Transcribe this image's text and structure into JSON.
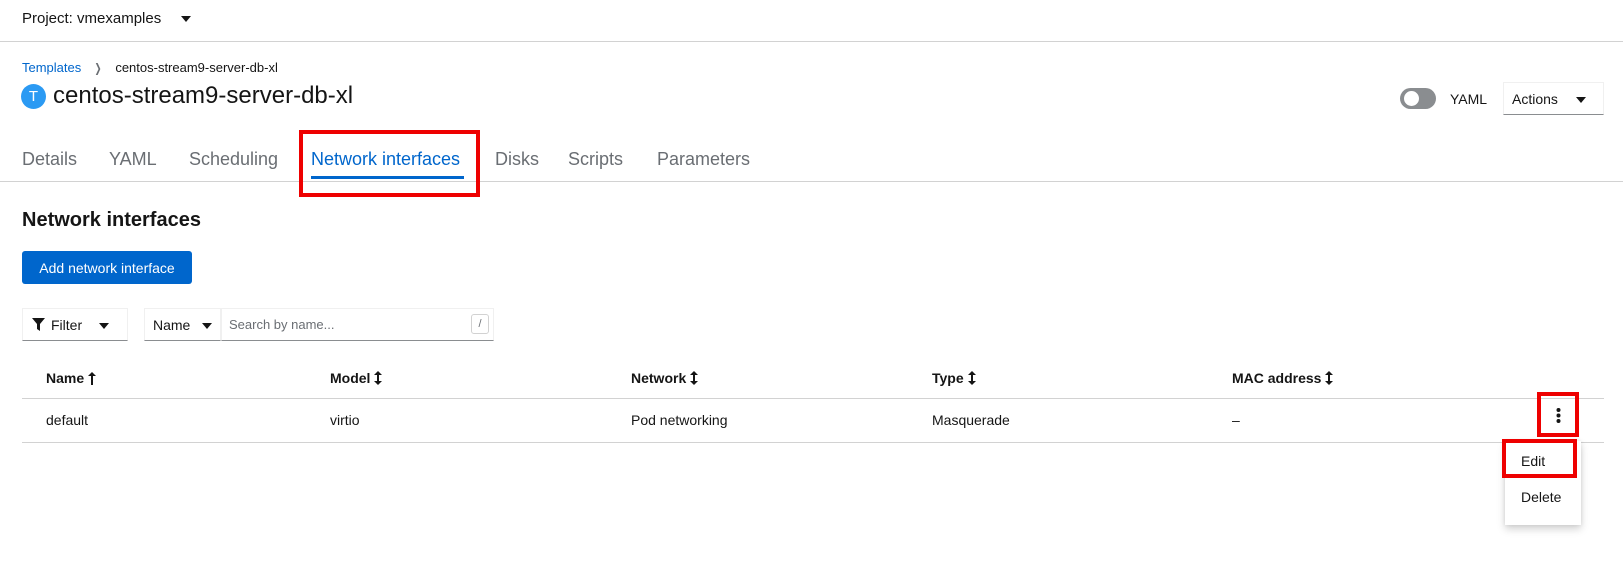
{
  "project": {
    "label": "Project: vmexamples"
  },
  "breadcrumb": {
    "parent": "Templates",
    "current": "centos-stream9-server-db-xl"
  },
  "header": {
    "badge": "T",
    "title": "centos-stream9-server-db-xl",
    "yaml_switch_label": "YAML",
    "actions_label": "Actions"
  },
  "tabs": [
    {
      "label": "Details"
    },
    {
      "label": "YAML"
    },
    {
      "label": "Scheduling"
    },
    {
      "label": "Network interfaces",
      "active": true
    },
    {
      "label": "Disks"
    },
    {
      "label": "Scripts"
    },
    {
      "label": "Parameters"
    }
  ],
  "section": {
    "title": "Network interfaces",
    "add_button": "Add network interface"
  },
  "toolbar": {
    "filter_label": "Filter",
    "attribute_select": "Name",
    "search_placeholder": "Search by name...",
    "shortcut_key": "/"
  },
  "table": {
    "columns": [
      "Name",
      "Model",
      "Network",
      "Type",
      "MAC address"
    ],
    "rows": [
      {
        "name": "default",
        "model": "virtio",
        "network": "Pod networking",
        "type": "Masquerade",
        "mac": "–"
      }
    ]
  },
  "row_menu": {
    "items": [
      "Edit",
      "Delete"
    ]
  },
  "colors": {
    "link": "#0066cc",
    "primary": "#0066cc",
    "highlight": "#ee0000",
    "badge": "#2b9af3"
  }
}
